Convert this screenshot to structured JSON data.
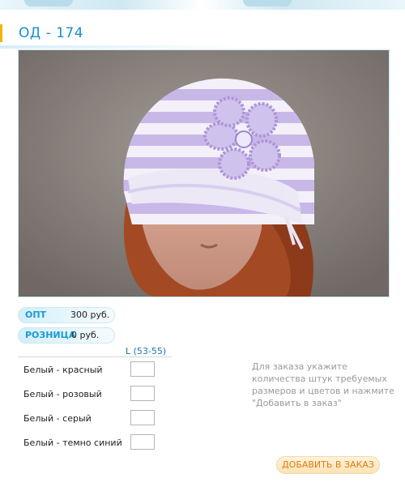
{
  "product": {
    "title": "ОД - 174",
    "photo_alt": "hat-photo"
  },
  "prices": {
    "wholesale_label": "ОПТ",
    "wholesale_value": "300 руб.",
    "retail_label": "РОЗНИЦА",
    "retail_value": "0 руб."
  },
  "order_table": {
    "size_header": "L (53-55)",
    "rows": [
      {
        "label": "Белый - красный",
        "qty": ""
      },
      {
        "label": "Белый - розовый",
        "qty": ""
      },
      {
        "label": "Белый - серый",
        "qty": ""
      },
      {
        "label": "Белый - темно синий",
        "qty": ""
      }
    ]
  },
  "hint": "Для заказа укажите количества штук требуемых размеров и цветов и нажмите \"Добавить в заказ\"",
  "add_button_label": "ДОБАВИТЬ В ЗАКАЗ",
  "colors": {
    "accent_blue": "#1a8fc8",
    "button_text": "#e07c12",
    "hat_lilac": "#c8b8e8"
  }
}
